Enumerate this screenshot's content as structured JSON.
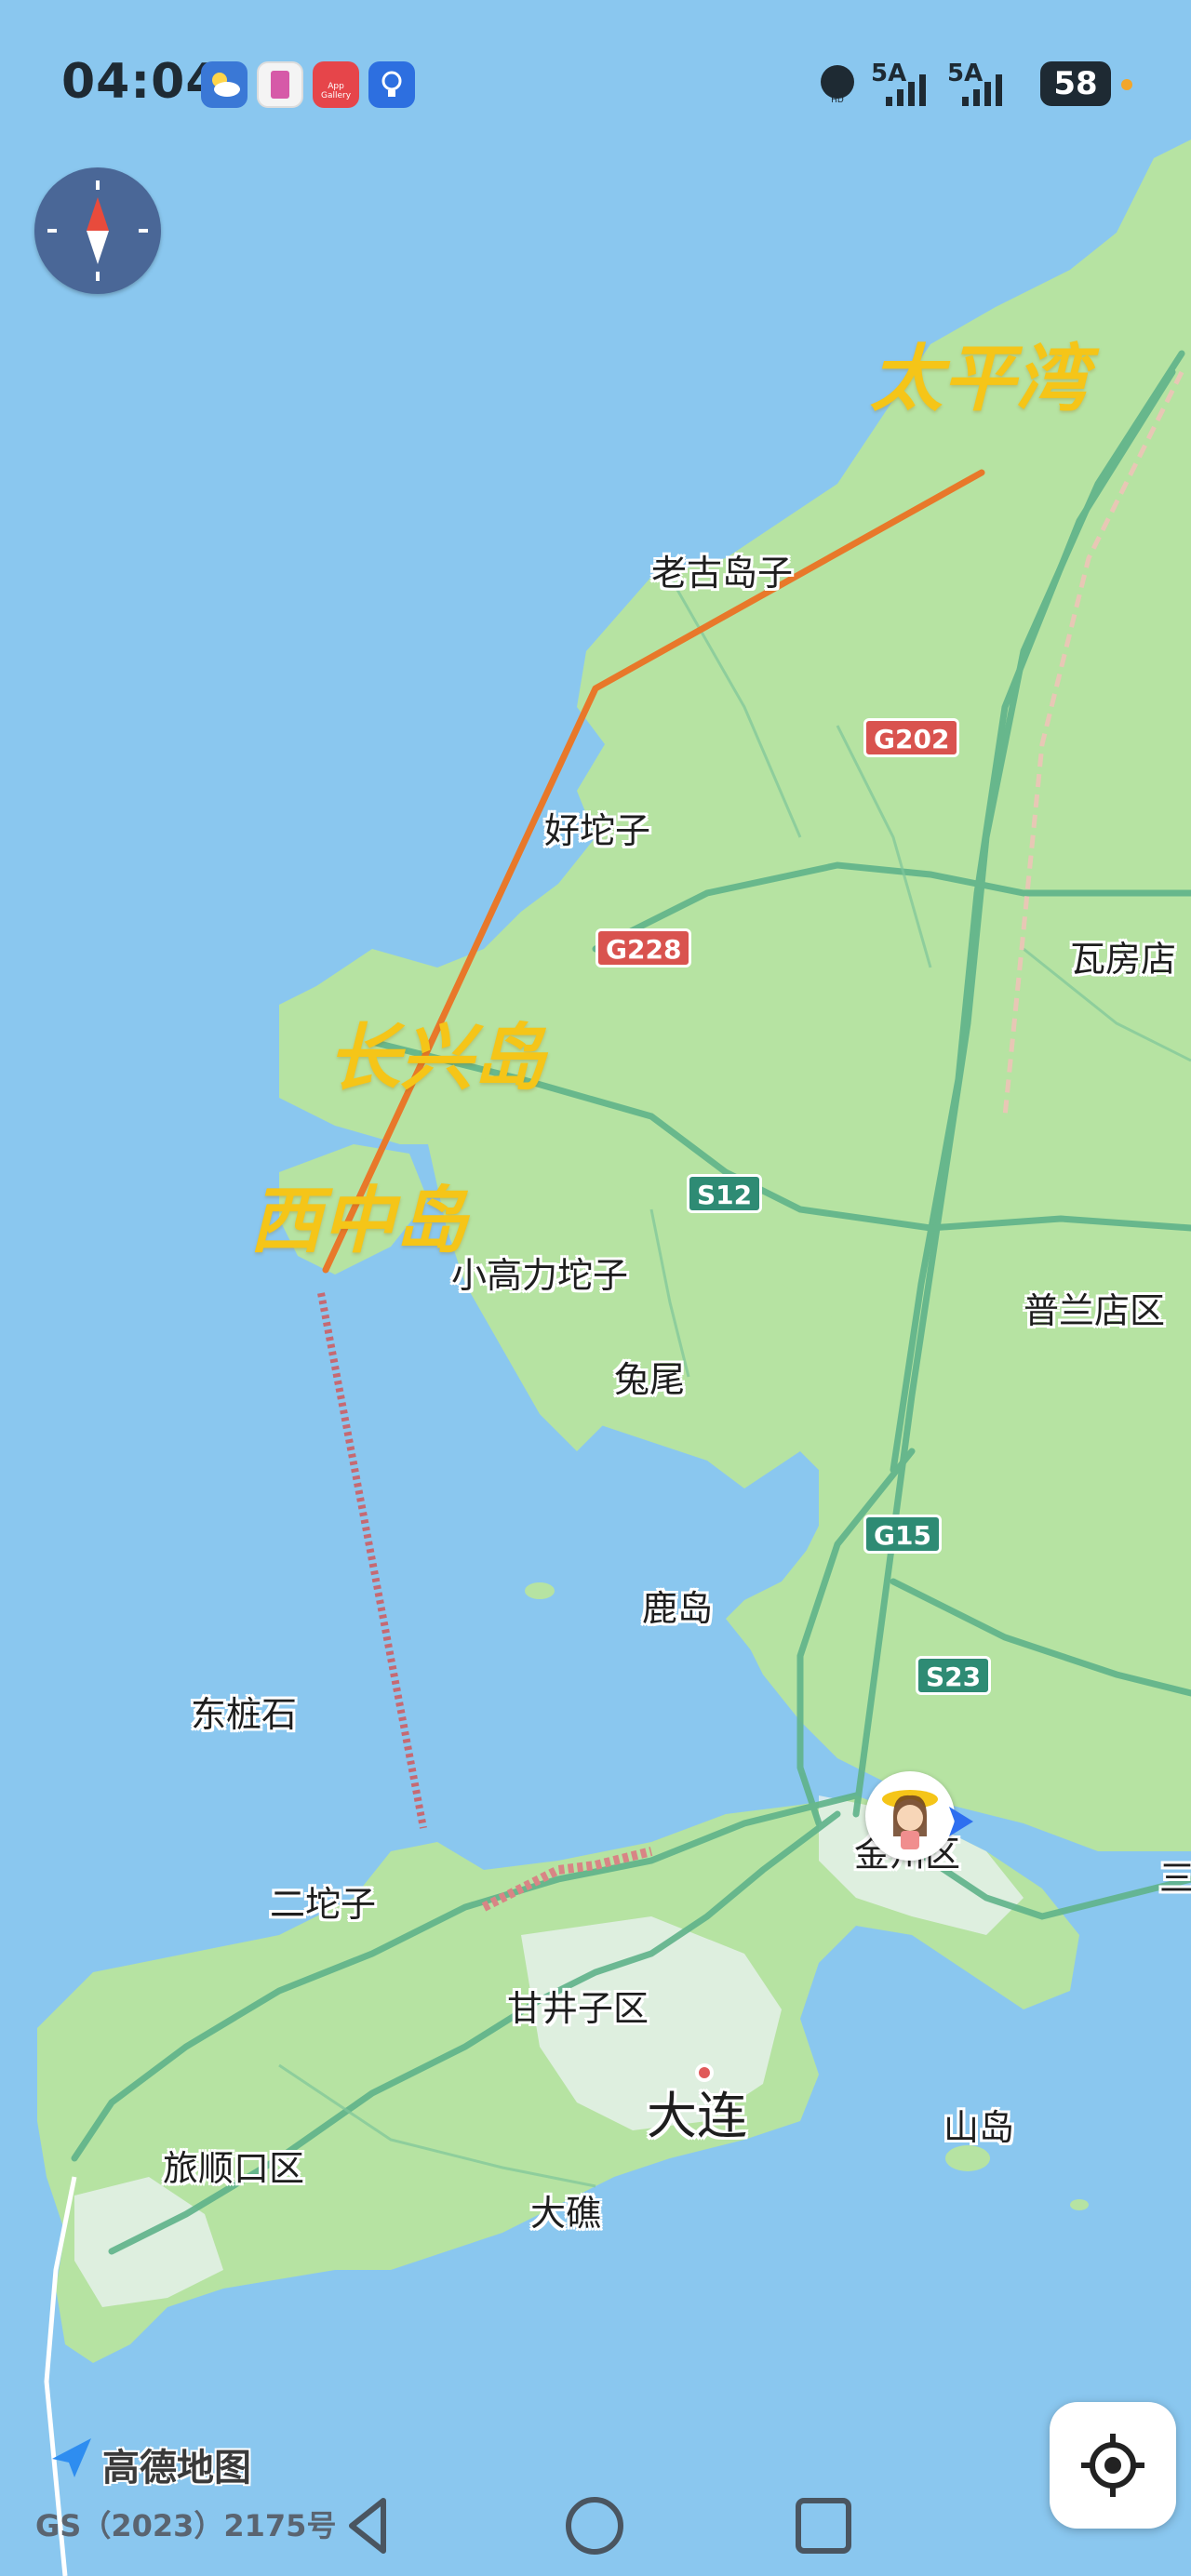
{
  "status_bar": {
    "time": "04:04",
    "app_icons": [
      "weather-icon",
      "notes-icon",
      "app-gallery-icon",
      "bulb-icon"
    ],
    "app_gallery_text": "App Gallery",
    "signal_1": "5A",
    "signal_2": "5A",
    "battery": "58"
  },
  "map": {
    "place_labels": {
      "laogudaozi": "老古岛子",
      "haotuozi": "好坨子",
      "wafangdian": "瓦房店",
      "xiaogaolituozi": "小高力坨子",
      "tuwei": "兔尾",
      "pulandian": "普兰店区",
      "ludao": "鹿岛",
      "dongzhuangshi": "东桩石",
      "jinzhou": "金州区",
      "ertuozi": "二坨子",
      "ganjingzi": "甘井子区",
      "dalian": "大连",
      "shandao": "山岛",
      "lvshunkou": "旅顺口区",
      "dajiao": "大礁",
      "san": "三"
    },
    "road_shields": {
      "g202": "G202",
      "g228": "G228",
      "s12": "S12",
      "g15": "G15",
      "s23": "S23"
    },
    "annotations": {
      "taipingwan": "太平湾",
      "changxingdao": "长兴岛",
      "xizhongdao": "西中岛"
    },
    "colors": {
      "water": "#8ac7ef",
      "land": "#b6e3a2",
      "road": "#5fb38a",
      "annotation_line": "#e8782a",
      "annotation_text": "#f5c518",
      "bridge_dotted": "#d0585c"
    }
  },
  "controls": {
    "compass": "compass-icon",
    "locate": "locate-icon"
  },
  "footer": {
    "brand": "高德地图",
    "gs_code": "GS（2023）2175号"
  },
  "nav_bar": [
    "back-icon",
    "home-icon",
    "recents-icon"
  ]
}
